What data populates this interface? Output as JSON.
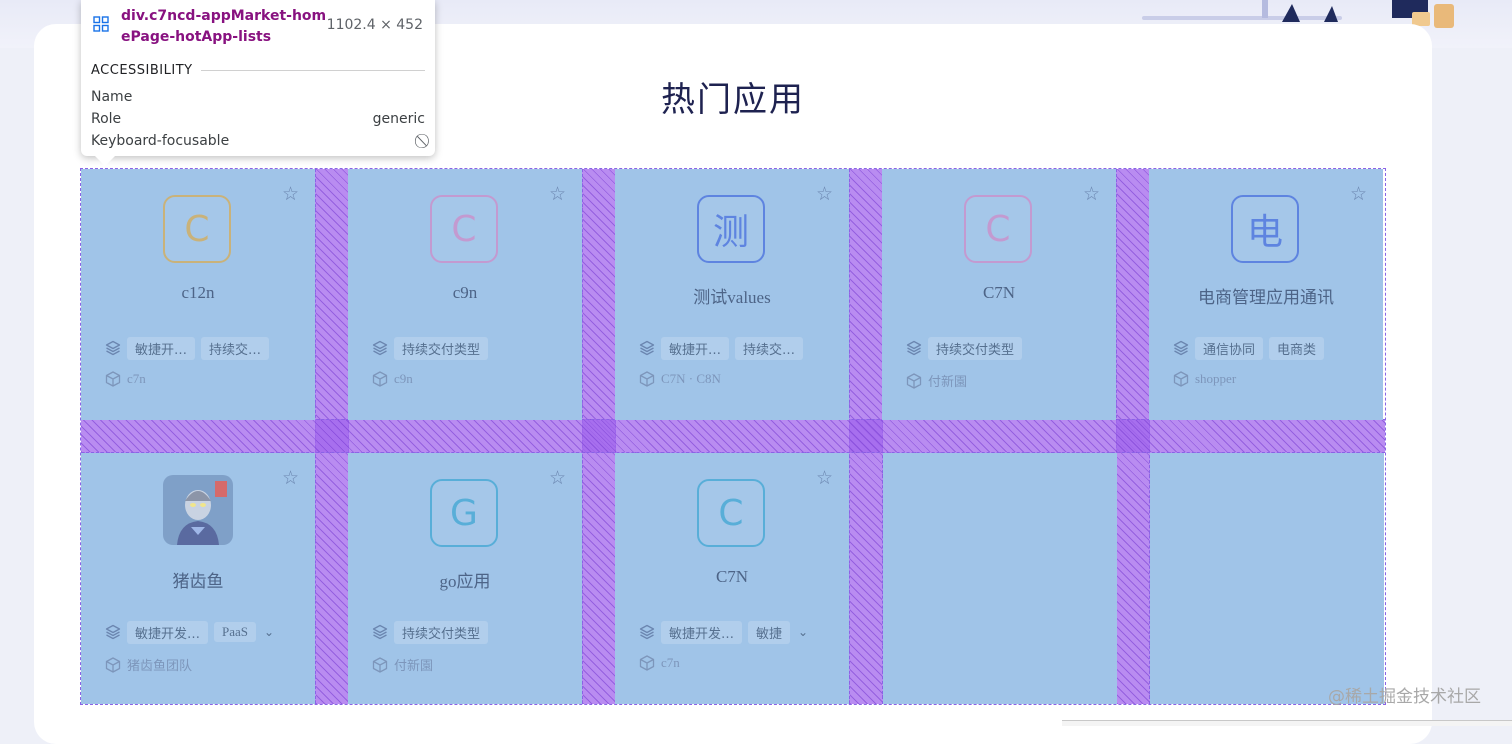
{
  "section_title": "热门应用",
  "tooltip": {
    "selector": "div.c7ncd-appMarket-homePage-hotApp-lists",
    "size": "1102.4 × 452",
    "section": "ACCESSIBILITY",
    "rows": [
      {
        "label": "Name",
        "value": ""
      },
      {
        "label": "Role",
        "value": "generic"
      },
      {
        "label": "Keyboard-focusable",
        "value": "⃠"
      }
    ]
  },
  "cards": [
    {
      "name": "c12n",
      "icon_letter": "C",
      "icon_color": "#c9b27a",
      "tags": [
        "敏捷开…",
        "持续交…"
      ],
      "team": "c7n"
    },
    {
      "name": "c9n",
      "icon_letter": "C",
      "icon_color": "#c39ad0",
      "tags": [
        "持续交付类型"
      ],
      "team": "c9n"
    },
    {
      "name": "测试values",
      "icon_letter": "测",
      "icon_color": "#5e84e0",
      "tags": [
        "敏捷开…",
        "持续交…"
      ],
      "team": "C7N · C8N"
    },
    {
      "name": "C7N",
      "icon_letter": "C",
      "icon_color": "#c39ad0",
      "tags": [
        "持续交付类型"
      ],
      "team": "付新園"
    },
    {
      "name": "电商管理应用通讯",
      "icon_letter": "电",
      "icon_color": "#5e84e0",
      "tags": [
        "通信协同",
        "电商类"
      ],
      "team": "shopper"
    },
    {
      "name": "猪齿鱼",
      "icon_image": "ultraman-avatar",
      "tags": [
        "敏捷开发…",
        "PaaS"
      ],
      "has_more": true,
      "team": "猪齿鱼团队"
    },
    {
      "name": "go应用",
      "icon_letter": "G",
      "icon_color": "#58aed8",
      "tags": [
        "持续交付类型"
      ],
      "team": "付新園"
    },
    {
      "name": "C7N",
      "icon_letter": "C",
      "icon_color": "#58aed8",
      "tags": [
        "敏捷开发…",
        "敏捷"
      ],
      "has_more": true,
      "team": "c7n"
    }
  ],
  "watermark": "@稀土掘金技术社区"
}
